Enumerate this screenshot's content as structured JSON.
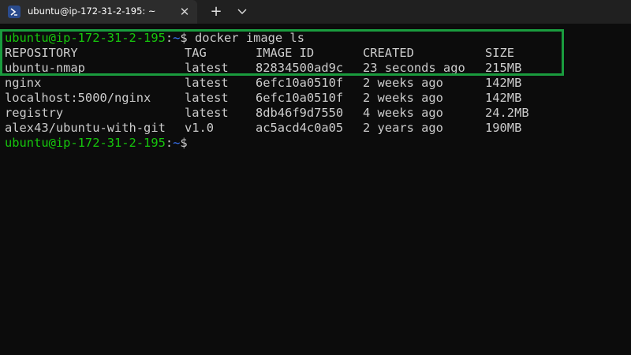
{
  "tab": {
    "title": "ubuntu@ip-172-31-2-195: ~",
    "icon": "powershell-terminal-icon",
    "close_glyph": "✕",
    "new_tab_glyph": "+"
  },
  "terminal": {
    "prompt": {
      "user_host": "ubuntu@ip-172-31-2-195",
      "sep": ":",
      "path": "~",
      "symbol": "$"
    },
    "command": " docker image ls",
    "headers": {
      "repository": "REPOSITORY",
      "tag": "TAG",
      "image_id": "IMAGE ID",
      "created": "CREATED",
      "size": "SIZE"
    },
    "rows": [
      {
        "repository": "ubuntu-nmap",
        "tag": "latest",
        "image_id": "82834500ad9c",
        "created": "23 seconds ago",
        "size": "215MB"
      },
      {
        "repository": "nginx",
        "tag": "latest",
        "image_id": "6efc10a0510f",
        "created": "2 weeks ago",
        "size": "142MB"
      },
      {
        "repository": "localhost:5000/nginx",
        "tag": "latest",
        "image_id": "6efc10a0510f",
        "created": "2 weeks ago",
        "size": "142MB"
      },
      {
        "repository": "registry",
        "tag": "latest",
        "image_id": "8db46f9d7550",
        "created": "4 weeks ago",
        "size": "24.2MB"
      },
      {
        "repository": "alex43/ubuntu-with-git",
        "tag": "v1.0",
        "image_id": "ac5acd4c0a05",
        "created": "2 years ago",
        "size": "190MB"
      }
    ]
  },
  "colors": {
    "background": "#0c0c0c",
    "prompt_user": "#16c60c",
    "prompt_path": "#3b78ff",
    "text": "#cccccc",
    "highlight_border": "#1a9c3e"
  }
}
